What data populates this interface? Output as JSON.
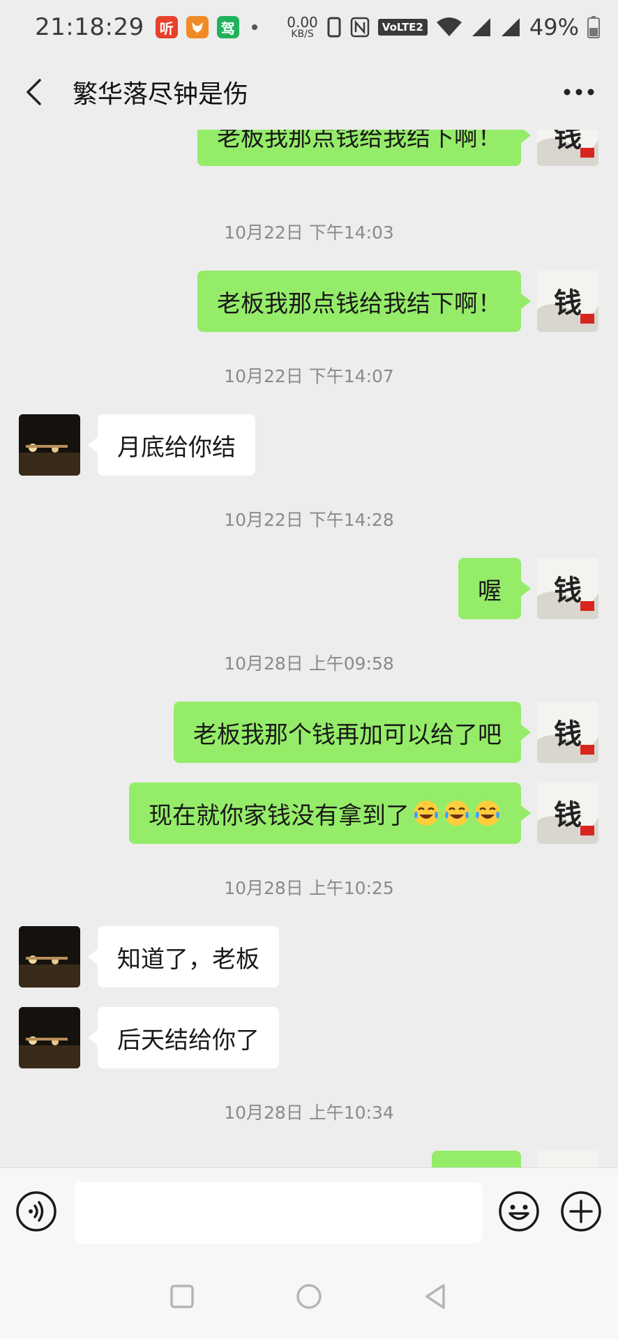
{
  "status_bar": {
    "time": "21:18:29",
    "apps": [
      {
        "name": "ting-app-icon",
        "label": "听",
        "color": "#e8402d"
      },
      {
        "name": "fox-app-icon",
        "label": "",
        "color": "#f08a24"
      },
      {
        "name": "drive-app-icon",
        "label": "驾",
        "color": "#20b25a"
      }
    ],
    "net_speed_value": "0.00",
    "net_speed_unit": "KB/S",
    "volte_label": "VoLTE2",
    "battery": "49%"
  },
  "header": {
    "title": "繁华落尽钟是伤"
  },
  "messages": [
    {
      "kind": "self",
      "text": "老板我那点钱给我结下啊！"
    },
    {
      "kind": "timestamp",
      "text": "10月22日 下午14:03"
    },
    {
      "kind": "self",
      "text": "老板我那点钱给我结下啊！"
    },
    {
      "kind": "timestamp",
      "text": "10月22日 下午14:07"
    },
    {
      "kind": "other",
      "text": "月底给你结"
    },
    {
      "kind": "timestamp",
      "text": "10月22日 下午14:28"
    },
    {
      "kind": "self",
      "text": "喔"
    },
    {
      "kind": "timestamp",
      "text": "10月28日 上午09:58"
    },
    {
      "kind": "self",
      "text": "老板我那个钱再加可以给了吧"
    },
    {
      "kind": "self",
      "text": "现在就你家钱没有拿到了"
    },
    {
      "kind": "timestamp",
      "text": "10月28日 上午10:25"
    },
    {
      "kind": "other",
      "text": "知道了，老板"
    },
    {
      "kind": "other",
      "text": "后天结给你了"
    },
    {
      "kind": "timestamp",
      "text": "10月28日 上午10:34"
    }
  ],
  "self_avatar_text": "钱",
  "emoji_icon": "laughing-crying-emoji",
  "colors": {
    "self_bubble": "#95ec69",
    "other_bubble": "#ffffff",
    "background": "#ededed"
  }
}
